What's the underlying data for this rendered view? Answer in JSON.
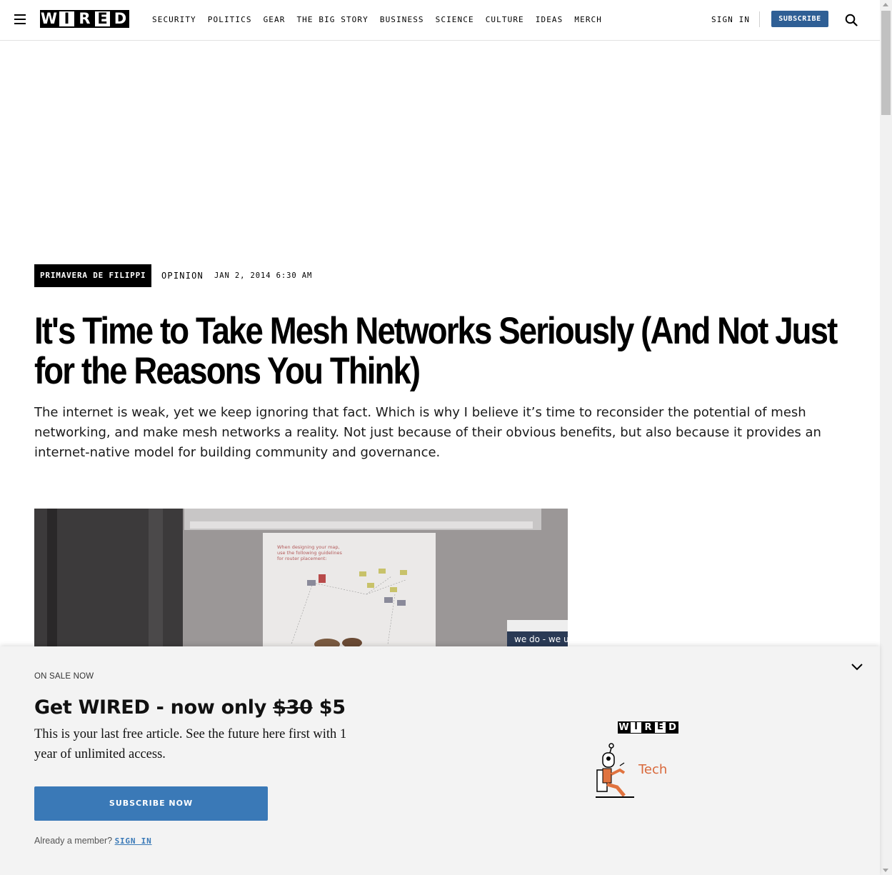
{
  "header": {
    "logo_letters": [
      "W",
      "I",
      "R",
      "E",
      "D"
    ],
    "nav": [
      "SECURITY",
      "POLITICS",
      "GEAR",
      "THE BIG STORY",
      "BUSINESS",
      "SCIENCE",
      "CULTURE",
      "IDEAS",
      "MERCH"
    ],
    "sign_in": "SIGN IN",
    "subscribe": "SUBSCRIBE"
  },
  "article": {
    "author": "PRIMAVERA DE FILIPPI",
    "rubric": "OPINION",
    "date": "JAN 2, 2014 6:30 AM",
    "headline": "It's Time to Take Mesh Networks Seriously (And Not Just for the Reasons You Think)",
    "dek": "The internet is weak, yet we keep ignoring that fact. Which is why I believe it’s time to reconsider the potential of mesh networking, and make mesh networks a reality. Not just because of their obvious benefits, but also because it provides an internet-native model for building community and governance."
  },
  "lead_image": {
    "slide_text": "When designing your map, use the following guidelines for router placement:",
    "caption_text": "we do - we u"
  },
  "paywall": {
    "on_sale": "ON SALE NOW",
    "offer_prefix": "Get WIRED - now only",
    "old_price": "$30",
    "new_price": "$5",
    "pitch": "This is your last free article. See the future here first with 1 year of unlimited access.",
    "button": "SUBSCRIBE NOW",
    "member_prompt": "Already a member?",
    "member_link": "SIGN IN",
    "promo_logo_letters": [
      "W",
      "I",
      "R",
      "E",
      "D"
    ],
    "promo_label": "Tech"
  },
  "colors": {
    "subscribe_bg": "#2f5f95",
    "button_bg": "#3a79b7",
    "promo_accent": "#d9683a"
  }
}
